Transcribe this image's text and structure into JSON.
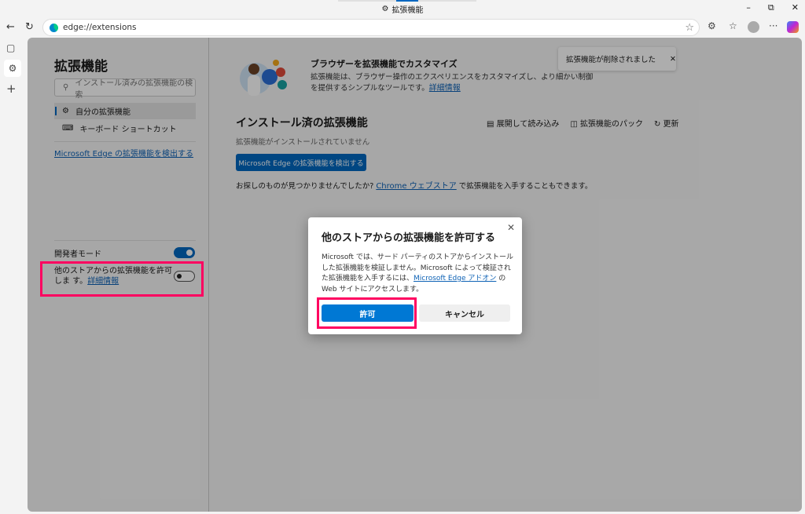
{
  "window": {
    "title": "拡張機能",
    "minimize": "–",
    "restore": "⧉",
    "close": "✕"
  },
  "toolbar": {
    "url": "edge://extensions"
  },
  "sidebar": {
    "title": "拡張機能",
    "search_placeholder": "インストール済みの拡張機能の検索",
    "items": [
      {
        "label": "自分の拡張機能",
        "selected": true
      },
      {
        "label": "キーボード ショートカット",
        "selected": false
      }
    ],
    "discover_link": "Microsoft Edge の拡張機能を検出する",
    "dev_mode_label": "開発者モード",
    "dev_mode_on": true,
    "other_stores_label": "他のストアからの拡張機能を許可しま す。",
    "other_stores_link": "詳細情報",
    "other_stores_on": false
  },
  "main": {
    "hero_title": "ブラウザーを拡張機能でカスタマイズ",
    "hero_text": "拡張機能は、ブラウザー操作のエクスペリエンスをカスタマイズし、より細かい制御を提供するシンプルなツールです。",
    "hero_link": "詳細情報",
    "section_title": "インストール済の拡張機能",
    "load_unpacked": "展開して読み込み",
    "pack": "拡張機能のパック",
    "refresh": "更新",
    "empty": "拡張機能がインストールされていません",
    "discover_button": "Microsoft Edge の拡張機能を検出する",
    "footer_prefix": "お探しのものが見つかりませんでしたか?",
    "footer_link": "Chrome ウェブストア",
    "footer_suffix": "で拡張機能を入手することもできます。"
  },
  "toast": {
    "text": "拡張機能が削除されました"
  },
  "dialog": {
    "title": "他のストアからの拡張機能を許可する",
    "body_1": "Microsoft では、サード パーティのストアからインストールした拡張機能を検証しません。Microsoft によって検証された拡張機能を入手するには、",
    "link": "Microsoft Edge アドオン",
    "body_2": " の Web サイトにアクセスします。",
    "allow": "許可",
    "cancel": "キャンセル"
  },
  "colors": {
    "accent": "#0067c0",
    "highlight": "#ff0060"
  }
}
